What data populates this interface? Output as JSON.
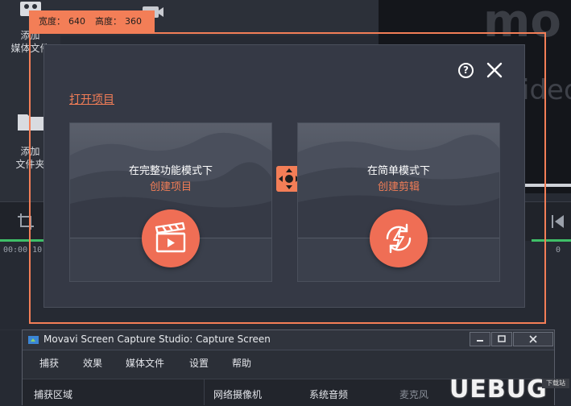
{
  "background_app": {
    "sidebar": [
      {
        "label_line1": "添加",
        "label_line2": "媒体文件",
        "icon": "film-icon"
      },
      {
        "label_line1": "添加",
        "label_line2": "文件夹",
        "icon": "folder-icon"
      }
    ],
    "brand_text": "mo",
    "preview_text": "ideo",
    "timecodes": [
      "00:00:10",
      "0"
    ]
  },
  "capture_area": {
    "width_label": "宽度：",
    "width_value": "640",
    "height_label": "高度：",
    "height_value": "360"
  },
  "dialog": {
    "help_label": "?",
    "open_project_link": "打开项目",
    "cards": [
      {
        "line1": "在完整功能模式下",
        "line2": "创建项目",
        "icon": "clapperboard-icon"
      },
      {
        "line1": "在简单模式下",
        "line2": "创建剪辑",
        "icon": "quick-edit-icon"
      }
    ]
  },
  "capture_window": {
    "title": "Movavi Screen Capture Studio: Capture Screen",
    "menu": [
      "捕获",
      "效果",
      "媒体文件",
      "设置",
      "帮助"
    ],
    "row": {
      "capture_area": "捕获区域",
      "webcam": "网络摄像机",
      "system_audio": "系统音频",
      "microphone": "麦克风"
    }
  },
  "watermark": {
    "text": "UEBUG",
    "small": "下载站"
  },
  "colors": {
    "accent": "#f37e57",
    "dialog_bg": "#353945",
    "icon_circle": "#ef6e55"
  }
}
